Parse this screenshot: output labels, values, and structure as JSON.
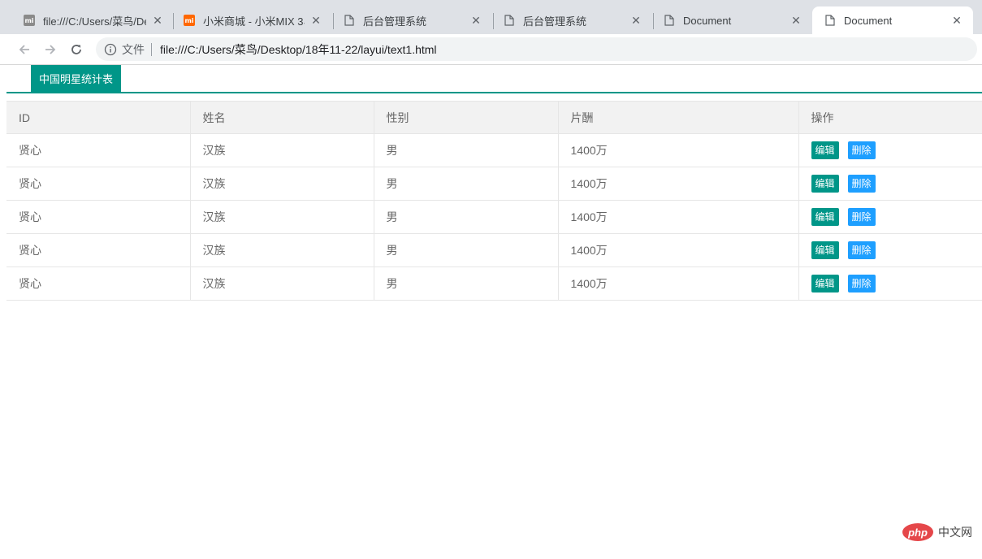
{
  "browser": {
    "tabs": [
      {
        "title": "file:///C:/Users/菜鸟/De",
        "icon": "mi-icon",
        "icon_color": "#8a8a8a",
        "active": false
      },
      {
        "title": "小米商城 - 小米MIX 3、",
        "icon": "mi-icon",
        "icon_color": "#ff6700",
        "active": false
      },
      {
        "title": "后台管理系统",
        "icon": "document-icon",
        "active": false
      },
      {
        "title": "后台管理系统",
        "icon": "document-icon",
        "active": false
      },
      {
        "title": "Document",
        "icon": "document-icon",
        "active": false
      },
      {
        "title": "Document",
        "icon": "document-icon",
        "active": true
      }
    ],
    "mi_glyph": "mi",
    "close_glyph": "✕",
    "address": {
      "scheme_label": "文件",
      "url": "file:///C:/Users/菜鸟/Desktop/18年11-22/layui/text1.html"
    }
  },
  "page": {
    "tab_title": "中国明星统计表",
    "accent_color": "#009688",
    "table": {
      "headers": [
        "ID",
        "姓名",
        "性别",
        "片酬",
        "操作"
      ],
      "rows": [
        {
          "id": "贤心",
          "name": "汉族",
          "gender": "男",
          "pay": "1400万"
        },
        {
          "id": "贤心",
          "name": "汉族",
          "gender": "男",
          "pay": "1400万"
        },
        {
          "id": "贤心",
          "name": "汉族",
          "gender": "男",
          "pay": "1400万"
        },
        {
          "id": "贤心",
          "name": "汉族",
          "gender": "男",
          "pay": "1400万"
        },
        {
          "id": "贤心",
          "name": "汉族",
          "gender": "男",
          "pay": "1400万"
        }
      ],
      "edit_label": "编辑",
      "delete_label": "删除",
      "edit_color": "#009688",
      "delete_color": "#1E9FFF"
    }
  },
  "watermark": {
    "logo_text": "php",
    "text": "中文网"
  }
}
